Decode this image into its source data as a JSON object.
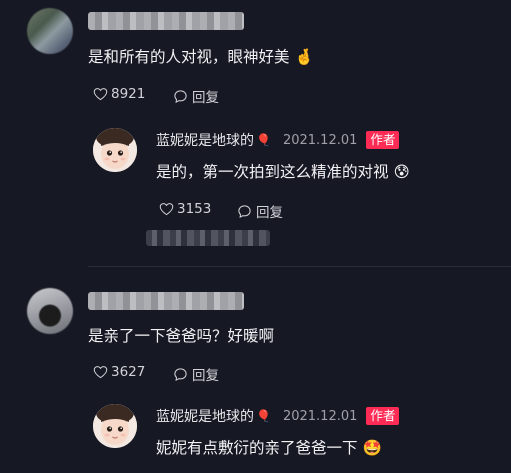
{
  "comments": [
    {
      "text": "是和所有的人对视，眼神好美",
      "emoji": "🤞",
      "likes": "8921",
      "reply_label": "回复",
      "reply": {
        "author": "蓝妮妮是地球的",
        "author_emoji": "🎈",
        "date": "2021.12.01",
        "badge": "作者",
        "text": "是的，第一次拍到这么精准的对视",
        "emoji": "😰",
        "likes": "3153",
        "reply_label": "回复"
      }
    },
    {
      "text": "是亲了一下爸爸吗？好暖啊",
      "likes": "3627",
      "reply_label": "回复",
      "reply": {
        "author": "蓝妮妮是地球的",
        "author_emoji": "🎈",
        "date": "2021.12.01",
        "badge": "作者",
        "text": "妮妮有点敷衍的亲了爸爸一下",
        "emoji": "🤩"
      }
    }
  ],
  "colors": {
    "background": "#161823",
    "badge": "#fe2c55",
    "text": "#f2f2f4",
    "muted": "#9fa0a8"
  },
  "icons": {
    "like": "heart-icon",
    "reply": "speech-bubble-icon"
  }
}
